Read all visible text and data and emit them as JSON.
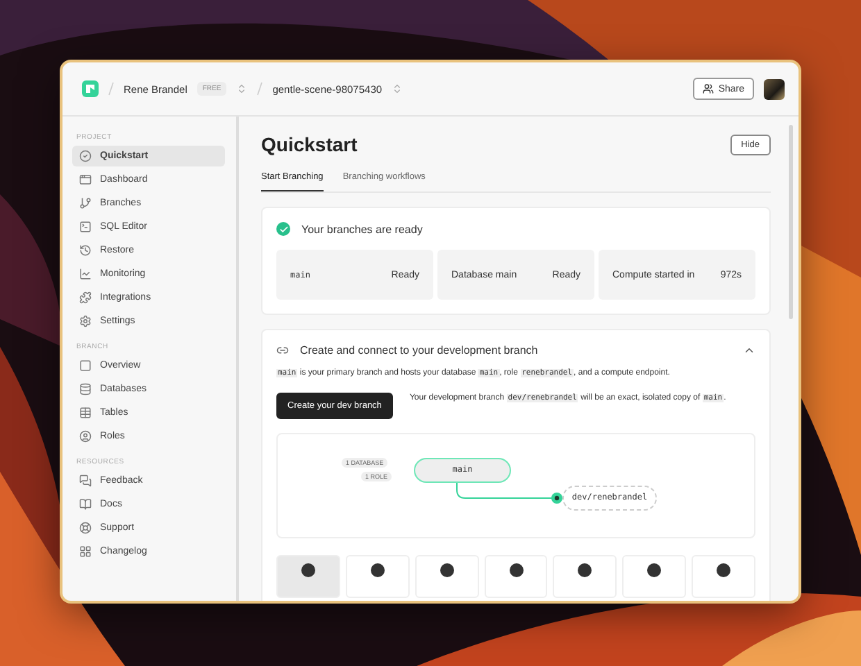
{
  "topbar": {
    "account": "Rene Brandel",
    "plan": "FREE",
    "project": "gentle-scene-98075430",
    "share": "Share"
  },
  "sidebar": {
    "sections": [
      {
        "title": "PROJECT",
        "items": [
          {
            "label": "Quickstart",
            "selected": true
          },
          {
            "label": "Dashboard",
            "selected": false
          },
          {
            "label": "Branches",
            "selected": false
          },
          {
            "label": "SQL Editor",
            "selected": false
          },
          {
            "label": "Restore",
            "selected": false
          },
          {
            "label": "Monitoring",
            "selected": false
          },
          {
            "label": "Integrations",
            "selected": false
          },
          {
            "label": "Settings",
            "selected": false
          }
        ]
      },
      {
        "title": "BRANCH",
        "items": [
          {
            "label": "Overview",
            "selected": false
          },
          {
            "label": "Databases",
            "selected": false
          },
          {
            "label": "Tables",
            "selected": false
          },
          {
            "label": "Roles",
            "selected": false
          }
        ]
      },
      {
        "title": "RESOURCES",
        "items": [
          {
            "label": "Feedback",
            "selected": false
          },
          {
            "label": "Docs",
            "selected": false
          },
          {
            "label": "Support",
            "selected": false
          },
          {
            "label": "Changelog",
            "selected": false
          }
        ]
      }
    ]
  },
  "main": {
    "title": "Quickstart",
    "hide": "Hide",
    "tabs": [
      {
        "label": "Start Branching",
        "selected": true
      },
      {
        "label": "Branching workflows",
        "selected": false
      }
    ],
    "ready_card": {
      "title": "Your branches are ready",
      "done": true,
      "items": [
        {
          "name": "main",
          "kind": "code",
          "status": "Ready"
        },
        {
          "name": "Database main",
          "kind": "text",
          "status": "Ready"
        },
        {
          "name": "Compute started in",
          "kind": "text",
          "status": "972s"
        }
      ]
    },
    "dev_card": {
      "title": "Create and connect to your development branch",
      "expanded": true,
      "intro": [
        {
          "kind": "code",
          "text": "main"
        },
        {
          "kind": "text",
          "text": " is your primary branch and hosts your database "
        },
        {
          "kind": "code",
          "text": "main"
        },
        {
          "kind": "text",
          "text": ", role "
        },
        {
          "kind": "code",
          "text": "renebrandel"
        },
        {
          "kind": "text",
          "text": ", and a compute endpoint."
        }
      ],
      "button": "Create your dev branch",
      "note": [
        {
          "kind": "text",
          "text": "Your development branch "
        },
        {
          "kind": "code",
          "text": "dev/renebrandel"
        },
        {
          "kind": "text",
          "text": " will be an exact, isolated copy of "
        },
        {
          "kind": "code",
          "text": "main"
        },
        {
          "kind": "text",
          "text": "."
        }
      ],
      "diagram": {
        "tags": [
          "1 DATABASE",
          "1 ROLE"
        ],
        "parent": "main",
        "child": "dev/renebrandel"
      },
      "frameworks": [
        {
          "selected": true
        },
        {
          "selected": false
        },
        {
          "selected": false
        },
        {
          "selected": false
        },
        {
          "selected": false
        },
        {
          "selected": false
        },
        {
          "selected": false
        }
      ]
    }
  }
}
